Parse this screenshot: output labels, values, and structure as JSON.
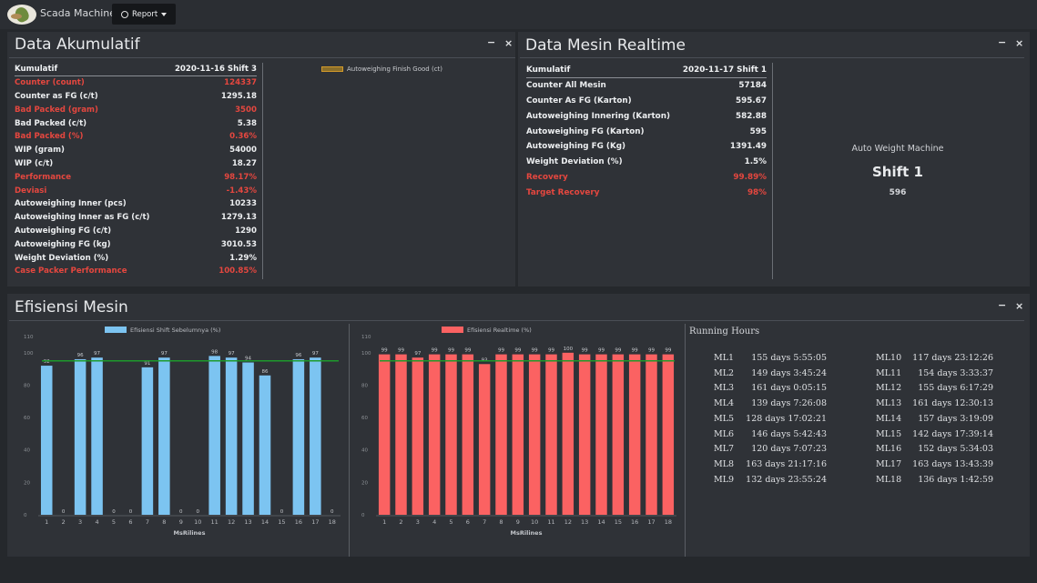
{
  "nav": {
    "brand": "Scada Machine",
    "report_label": "Report"
  },
  "akumulatif": {
    "title": "Data Akumulatif",
    "header_label": "Kumulatif",
    "header_date": "2020-11-16 Shift 3",
    "rows": [
      {
        "label": "Counter (count)",
        "value": "124337",
        "red": true
      },
      {
        "label": "Counter as FG (c/t)",
        "value": "1295.18",
        "red": false
      },
      {
        "label": "Bad Packed (gram)",
        "value": "3500",
        "red": true
      },
      {
        "label": "Bad Packed (c/t)",
        "value": "5.38",
        "red": false
      },
      {
        "label": "Bad Packed (%)",
        "value": "0.36%",
        "red": true
      },
      {
        "label": "WIP (gram)",
        "value": "54000",
        "red": false
      },
      {
        "label": "WIP (c/t)",
        "value": "18.27",
        "red": false
      },
      {
        "label": "Performance",
        "value": "98.17%",
        "red": true
      },
      {
        "label": "Deviasi",
        "value": "-1.43%",
        "red": true
      },
      {
        "label": "Autoweighing Inner (pcs)",
        "value": "10233",
        "red": false
      },
      {
        "label": "Autoweighing Inner as FG (c/t)",
        "value": "1279.13",
        "red": false
      },
      {
        "label": "Autoweighing FG (c/t)",
        "value": "1290",
        "red": false
      },
      {
        "label": "Autoweighing FG (kg)",
        "value": "3010.53",
        "red": false
      },
      {
        "label": "Weight Deviation (%)",
        "value": "1.29%",
        "red": false
      },
      {
        "label": "Case Packer Performance",
        "value": "100.85%",
        "red": true
      }
    ],
    "legend": "Autoweighing Finish Good (ct)"
  },
  "realtime": {
    "title": "Data Mesin Realtime",
    "header_label": "Kumulatif",
    "header_date": "2020-11-17 Shift 1",
    "rows": [
      {
        "label": "Counter All Mesin",
        "value": "57184",
        "red": false
      },
      {
        "label": "Counter As FG (Karton)",
        "value": "595.67",
        "red": false
      },
      {
        "label": "Autoweighing Innering (Karton)",
        "value": "582.88",
        "red": false
      },
      {
        "label": "Autoweighing FG (Karton)",
        "value": "595",
        "red": false
      },
      {
        "label": "Autoweighing FG (Kg)",
        "value": "1391.49",
        "red": false
      },
      {
        "label": "Weight Deviation (%)",
        "value": "1.5%",
        "red": false
      },
      {
        "label": "Recovery",
        "value": "99.89%",
        "red": true
      },
      {
        "label": "Target Recovery",
        "value": "98%",
        "red": true
      }
    ],
    "auto_weight_label": "Auto Weight Machine",
    "shift_label": "Shift 1",
    "shift_value": "596"
  },
  "efisiensi": {
    "title": "Efisiensi Mesin"
  },
  "chart_data": [
    {
      "type": "bar",
      "title": "",
      "series": [
        {
          "name": "Efisiensi Shift Sebelumnya (%)",
          "values": [
            92,
            0,
            96,
            97,
            0,
            0,
            91,
            97,
            0,
            0,
            98,
            97,
            94,
            86,
            0,
            96,
            97,
            0
          ]
        }
      ],
      "categories": [
        "1",
        "2",
        "3",
        "4",
        "5",
        "6",
        "7",
        "8",
        "9",
        "10",
        "11",
        "12",
        "13",
        "14",
        "15",
        "16",
        "17",
        "18"
      ],
      "xlabel": "MsRilines",
      "ylabel": "",
      "ylim": [
        0,
        110
      ],
      "yticks": [
        "0",
        "20",
        "40",
        "60",
        "80",
        "100",
        "110"
      ],
      "target_line": 95,
      "bar_color": "#7cc4f1",
      "target_color": "#1e9b2b",
      "grid": false,
      "legend_position": "top-center"
    },
    {
      "type": "bar",
      "title": "",
      "series": [
        {
          "name": "Efisiensi Realtime (%)",
          "values": [
            99,
            99,
            97,
            99,
            99,
            99,
            93,
            99,
            99,
            99,
            99,
            100,
            99,
            99,
            99,
            99,
            99,
            99
          ]
        }
      ],
      "categories": [
        "1",
        "2",
        "3",
        "4",
        "5",
        "6",
        "7",
        "8",
        "9",
        "10",
        "11",
        "12",
        "13",
        "14",
        "15",
        "16",
        "17",
        "18"
      ],
      "xlabel": "MsRilines",
      "ylabel": "",
      "ylim": [
        0,
        110
      ],
      "yticks": [
        "0",
        "20",
        "40",
        "60",
        "80",
        "100",
        "110"
      ],
      "target_line": 95,
      "bar_color": "#fb6262",
      "target_color": "#1e9b2b",
      "grid": false,
      "legend_position": "top-center"
    }
  ],
  "running_hours": {
    "title": "Running Hours",
    "left": [
      {
        "ml": "ML1",
        "val": "155 days 5:55:05"
      },
      {
        "ml": "ML2",
        "val": "149 days 3:45:24"
      },
      {
        "ml": "ML3",
        "val": "161 days 0:05:15"
      },
      {
        "ml": "ML4",
        "val": "139 days 7:26:08"
      },
      {
        "ml": "ML5",
        "val": "128 days 17:02:21"
      },
      {
        "ml": "ML6",
        "val": "146 days 5:42:43"
      },
      {
        "ml": "ML7",
        "val": "120 days 7:07:23"
      },
      {
        "ml": "ML8",
        "val": "163 days 21:17:16"
      },
      {
        "ml": "ML9",
        "val": "132 days 23:55:24"
      }
    ],
    "right": [
      {
        "ml": "ML10",
        "val": "117 days 23:12:26"
      },
      {
        "ml": "ML11",
        "val": "154 days 3:33:37"
      },
      {
        "ml": "ML12",
        "val": "155 days 6:17:29"
      },
      {
        "ml": "ML13",
        "val": "161 days 12:30:13"
      },
      {
        "ml": "ML14",
        "val": "157 days 3:19:09"
      },
      {
        "ml": "ML15",
        "val": "142 days 17:39:14"
      },
      {
        "ml": "ML16",
        "val": "152 days 5:34:03"
      },
      {
        "ml": "ML17",
        "val": "163 days 13:43:39"
      },
      {
        "ml": "ML18",
        "val": "136 days 1:42:59"
      }
    ]
  },
  "icons": {
    "minimize": "minimize-icon",
    "close": "close-icon"
  },
  "window_controls": {
    "minimize": "−",
    "close": "×"
  }
}
